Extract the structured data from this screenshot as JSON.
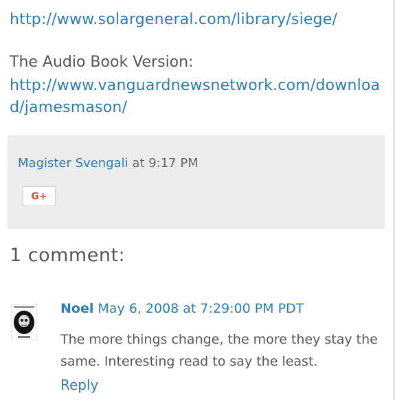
{
  "post": {
    "link1": "http://www.solargeneral.com/library/siege/",
    "audio_label": "The Audio Book Version:",
    "link2": "http://www.vanguardnewsnetwork.com/download/jamesmason/"
  },
  "footer": {
    "author": "Magister Svengali",
    "at": "at",
    "time": "9:17 PM",
    "share_button": "G+"
  },
  "comments": {
    "title": "1 comment:",
    "items": [
      {
        "author": "Noel",
        "date": "May 6, 2008 at 7:29:00 PM PDT",
        "body": "The more things change, the more they stay the same. Interesting read to say the least.",
        "reply": "Reply",
        "avatar_icon": "skull-avatar-icon"
      }
    ]
  },
  "colors": {
    "link": "#2a7db3",
    "footer_bg": "#ececec",
    "gplus": "#dd4b39"
  }
}
